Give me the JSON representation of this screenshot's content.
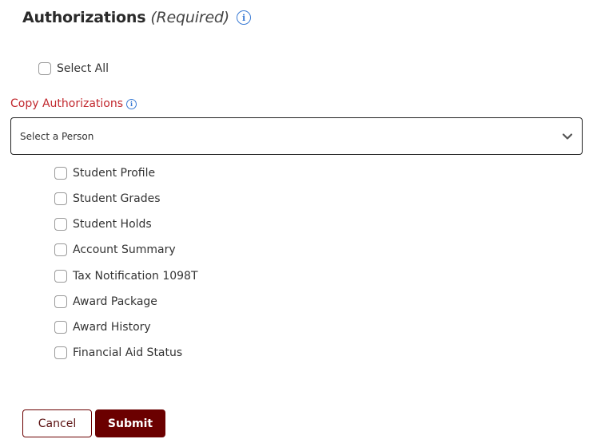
{
  "header": {
    "title": "Authorizations",
    "required": "(Required)",
    "info_icon": "i"
  },
  "select_all": {
    "label": "Select All",
    "checked": false
  },
  "copy_authorizations": {
    "label": "Copy Authorizations",
    "info_icon": "i",
    "select_placeholder": "Select a Person"
  },
  "authorizations": [
    {
      "label": "Student Profile",
      "checked": false
    },
    {
      "label": "Student Grades",
      "checked": false
    },
    {
      "label": "Student Holds",
      "checked": false
    },
    {
      "label": "Account Summary",
      "checked": false
    },
    {
      "label": "Tax Notification 1098T",
      "checked": false
    },
    {
      "label": "Award Package",
      "checked": false
    },
    {
      "label": "Award History",
      "checked": false
    },
    {
      "label": "Financial Aid Status",
      "checked": false
    }
  ],
  "buttons": {
    "cancel": "Cancel",
    "submit": "Submit"
  },
  "colors": {
    "accent": "#6b0000",
    "label_red": "#c1272d",
    "info_blue": "#3a7bd5"
  }
}
